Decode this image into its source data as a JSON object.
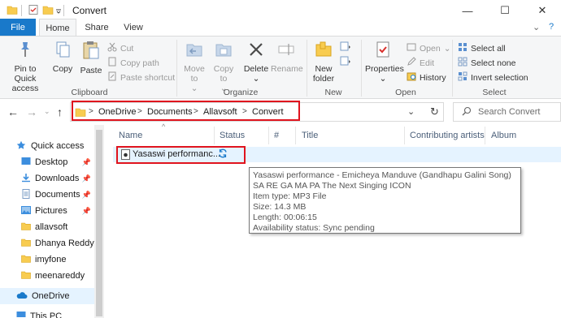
{
  "window": {
    "title": "Convert",
    "minimize_glyph": "—",
    "maximize_glyph": "☐",
    "close_glyph": "✕"
  },
  "tabs": {
    "file": "File",
    "home": "Home",
    "share": "Share",
    "view": "View",
    "collapse_glyph": "⌄",
    "help_glyph": "?"
  },
  "ribbon": {
    "clipboard": {
      "pin_label": "Pin to Quick access",
      "copy_label": "Copy",
      "paste_label": "Paste",
      "cut_label": "Cut",
      "copy_path_label": "Copy path",
      "paste_shortcut_label": "Paste shortcut",
      "group_label": "Clipboard"
    },
    "organize": {
      "move_to_label": "Move to",
      "copy_to_label": "Copy to",
      "delete_label": "Delete",
      "rename_label": "Rename",
      "group_label": "Organize"
    },
    "new": {
      "new_folder_label": "New folder",
      "group_label": "New"
    },
    "open": {
      "properties_label": "Properties",
      "open_label": "Open",
      "edit_label": "Edit",
      "history_label": "History",
      "group_label": "Open"
    },
    "select": {
      "select_all_label": "Select all",
      "select_none_label": "Select none",
      "invert_selection_label": "Invert selection",
      "group_label": "Select"
    }
  },
  "address": {
    "crumbs": [
      "OneDrive",
      "Documents",
      "Allavsoft",
      "Convert"
    ],
    "separator": ">",
    "search_placeholder": "Search Convert"
  },
  "nav_pane": {
    "quick_access": "Quick access",
    "items": [
      {
        "label": "Desktop",
        "pinned": true
      },
      {
        "label": "Downloads",
        "pinned": true
      },
      {
        "label": "Documents",
        "pinned": true
      },
      {
        "label": "Pictures",
        "pinned": true
      },
      {
        "label": "allavsoft",
        "pinned": false
      },
      {
        "label": "Dhanya Reddy p",
        "pinned": false
      },
      {
        "label": "imyfone",
        "pinned": false
      },
      {
        "label": "meenareddy",
        "pinned": false
      }
    ],
    "onedrive": "OneDrive",
    "this_pc": "This PC"
  },
  "columns": {
    "name": "Name",
    "status": "Status",
    "number": "#",
    "title": "Title",
    "contributing_artists": "Contributing artists",
    "album": "Album"
  },
  "file": {
    "name": "Yasaswi performanc..."
  },
  "tooltip": {
    "title_line": "Yasaswi performance - Emicheya Manduve (Gandhapu Galini Song) SA RE GA MA PA The Next Singing ICON",
    "item_type": "Item type: MP3 File",
    "size": "Size: 14.3 MB",
    "length": "Length: 00:06:15",
    "availability": "Availability status: Sync pending"
  },
  "colors": {
    "accent": "#1979ca",
    "highlight_red": "#e0141e",
    "selection": "#e5f3ff",
    "folder_yellow": "#f8cc50"
  }
}
